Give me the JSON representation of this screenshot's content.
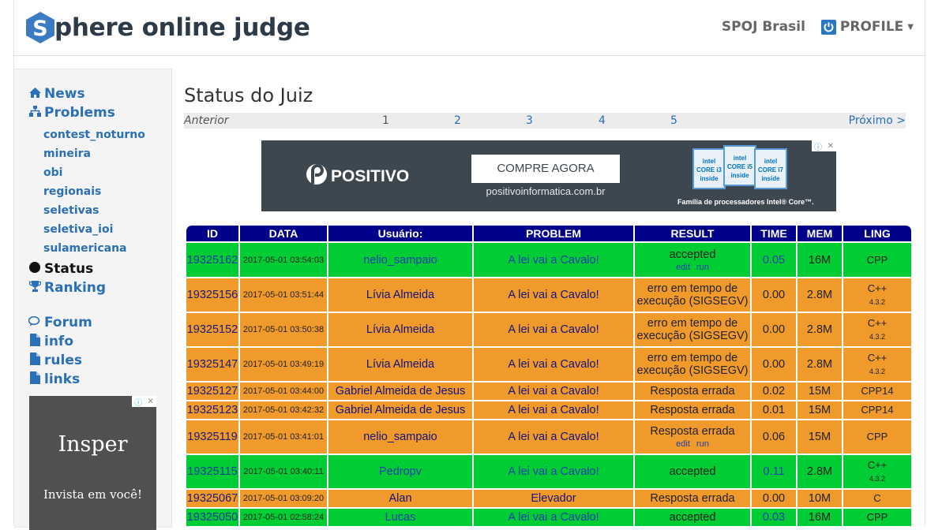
{
  "header": {
    "logo_letter": "S",
    "logo_text": "phere online judge",
    "site_link": "SPOJ Brasil",
    "profile_label": "PROFILE"
  },
  "sidebar": {
    "items": [
      {
        "label": "News",
        "icon": "home-icon"
      },
      {
        "label": "Problems",
        "icon": "sitemap-icon"
      }
    ],
    "sub_items": [
      "contest_noturno",
      "mineira",
      "obi",
      "regionais",
      "seletivas",
      "seletiva_ioi",
      "sulamericana"
    ],
    "status_label": "Status",
    "ranking_label": "Ranking",
    "forum_label": "Forum",
    "info_label": "info",
    "rules_label": "rules",
    "links_label": "links",
    "ad": {
      "title": "Insper",
      "tagline": "Invista em você!"
    }
  },
  "main": {
    "title": "Status do Juiz",
    "pager": {
      "prev": "Anterior",
      "pages": [
        "1",
        "2",
        "3",
        "4",
        "5"
      ],
      "next": "Próximo >"
    },
    "ad": {
      "brand": "POSITIVO",
      "cta": "COMPRE AGORA",
      "url": "positivoinformatica.com.br",
      "family": "Família de processadores Intel® Core™.",
      "chips": [
        "CORE i3",
        "CORE i5",
        "CORE i7"
      ],
      "chip_brand": "intel",
      "chip_sub": "inside"
    }
  },
  "table": {
    "headers": [
      "ID",
      "DATA",
      "Usuário:",
      "PROBLEM",
      "RESULT",
      "TIME",
      "MEM",
      "LING"
    ],
    "rows": [
      {
        "id": "19325162",
        "date": "2017-05-01 03:54:03",
        "user": "nelio_sampaio",
        "problem": "A lei vai a Cavalo!",
        "result": "accepted",
        "edit": "edit",
        "run": "run",
        "time": "0.05",
        "mem": "16M",
        "lang": "CPP",
        "lang_ver": "",
        "status": "ok"
      },
      {
        "id": "19325156",
        "date": "2017-05-01 03:51:44",
        "user": "Lívia Almeida",
        "problem": "A lei vai a Cavalo!",
        "result": "erro em tempo de execução (SIGSEGV)",
        "time": "0.00",
        "mem": "2.8M",
        "lang": "C++",
        "lang_ver": "4.3.2",
        "status": "bad"
      },
      {
        "id": "19325152",
        "date": "2017-05-01 03:50:38",
        "user": "Lívia Almeida",
        "problem": "A lei vai a Cavalo!",
        "result": "erro em tempo de execução (SIGSEGV)",
        "time": "0.00",
        "mem": "2.8M",
        "lang": "C++",
        "lang_ver": "4.3.2",
        "status": "bad"
      },
      {
        "id": "19325147",
        "date": "2017-05-01 03:49:19",
        "user": "Lívia Almeida",
        "problem": "A lei vai a Cavalo!",
        "result": "erro em tempo de execução (SIGSEGV)",
        "time": "0.00",
        "mem": "2.8M",
        "lang": "C++",
        "lang_ver": "4.3.2",
        "status": "bad"
      },
      {
        "id": "19325127",
        "date": "2017-05-01 03:44:00",
        "user": "Gabriel Almeida de Jesus",
        "problem": "A lei vai a Cavalo!",
        "result": "Resposta errada",
        "time": "0.02",
        "mem": "15M",
        "lang": "CPP14",
        "lang_ver": "",
        "status": "bad"
      },
      {
        "id": "19325123",
        "date": "2017-05-01 03:42:32",
        "user": "Gabriel Almeida de Jesus",
        "problem": "A lei vai a Cavalo!",
        "result": "Resposta errada",
        "time": "0.01",
        "mem": "15M",
        "lang": "CPP14",
        "lang_ver": "",
        "status": "bad"
      },
      {
        "id": "19325119",
        "date": "2017-05-01 03:41:01",
        "user": "nelio_sampaio",
        "problem": "A lei vai a Cavalo!",
        "result": "Resposta errada",
        "edit": "edit",
        "run": "run",
        "time": "0.06",
        "mem": "15M",
        "lang": "CPP",
        "lang_ver": "",
        "status": "bad"
      },
      {
        "id": "19325115",
        "date": "2017-05-01 03:40:11",
        "user": "Pedropv",
        "problem": "A lei vai a Cavalo!",
        "result": "accepted",
        "time": "0.11",
        "mem": "2.8M",
        "lang": "C++",
        "lang_ver": "4.3.2",
        "status": "ok"
      },
      {
        "id": "19325067",
        "date": "2017-05-01 03:09:20",
        "user": "Alan",
        "problem": "Elevador",
        "result": "Resposta errada",
        "time": "0.00",
        "mem": "10M",
        "lang": "C",
        "lang_ver": "",
        "status": "bad"
      },
      {
        "id": "19325050",
        "date": "2017-05-01 02:58:24",
        "user": "Lucas",
        "problem": "A lei vai a Cavalo!",
        "result": "accepted",
        "time": "0.03",
        "mem": "16M",
        "lang": "CPP",
        "lang_ver": "",
        "status": "ok"
      }
    ]
  },
  "colors": {
    "accepted": "#00cc33",
    "error": "#f09a2b",
    "header_bg": "#00008b",
    "link": "#2a6fb7",
    "logo": "#2d3a48"
  }
}
